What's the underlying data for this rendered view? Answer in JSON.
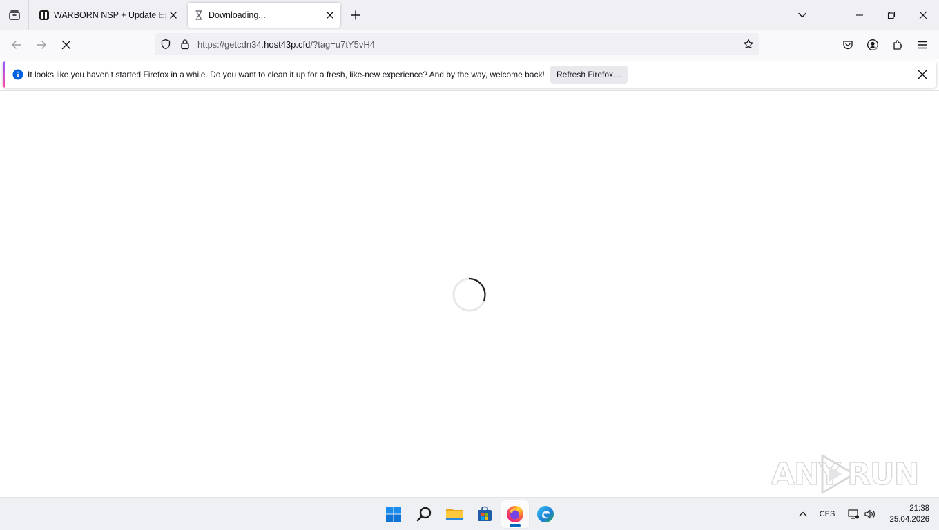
{
  "tabs": [
    {
      "title": "WARBORN NSP + Update Epic Multiplayer Xbox",
      "active": false
    },
    {
      "title": "Downloading...",
      "active": true
    }
  ],
  "url": {
    "scheme": "https://",
    "subdomain": "getcdn34.",
    "host": "host43p.cfd",
    "path": "/?tag=u7tY5vH4"
  },
  "notification": {
    "message": "It looks like you haven’t started Firefox in a while. Do you want to clean it up for a fresh, like-new experience? And by the way, welcome back!",
    "button_label": "Refresh Firefox…"
  },
  "watermark": {
    "left": "ANY",
    "right": "RUN"
  },
  "taskbar": {
    "apps": [
      "start-icon",
      "search-icon",
      "file-explorer-icon",
      "store-icon",
      "firefox-icon",
      "edge-icon"
    ],
    "language": "CES",
    "time": "21:38",
    "date": "25.04.2026"
  },
  "colors": {
    "accent": "#0061e0",
    "tab_strip": "#f0f0f4",
    "taskbar": "#eef0f3"
  }
}
